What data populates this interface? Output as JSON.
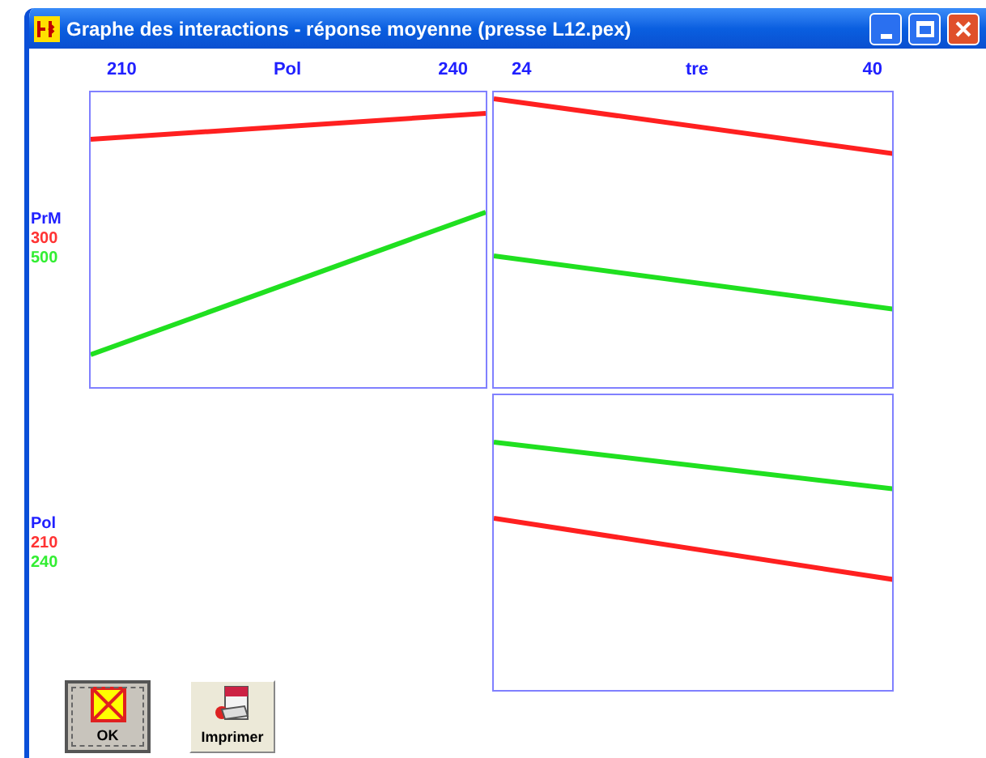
{
  "window": {
    "title": "Graphe des interactions - réponse moyenne (presse L12.pex)"
  },
  "axis_headers": [
    {
      "min": "210",
      "name": "Pol",
      "max": "240"
    },
    {
      "min": "24",
      "name": "tre",
      "max": "40"
    }
  ],
  "legends": [
    {
      "factor": "PrM",
      "levels": [
        {
          "label": "300",
          "color": "#ff3333"
        },
        {
          "label": "500",
          "color": "#33ee33"
        }
      ]
    },
    {
      "factor": "Pol",
      "levels": [
        {
          "label": "210",
          "color": "#ff3333"
        },
        {
          "label": "240",
          "color": "#33ee33"
        }
      ]
    }
  ],
  "rows": [
    {
      "cells": [
        {
          "kind": "plot",
          "lines": [
            {
              "color": "#ff2020"
            },
            {
              "color": "#20e020"
            }
          ]
        },
        {
          "kind": "plot",
          "lines": [
            {
              "color": "#ff2020"
            },
            {
              "color": "#20e020"
            }
          ]
        }
      ]
    },
    {
      "cells": [
        {
          "kind": "empty"
        },
        {
          "kind": "plot",
          "lines": [
            {
              "color": "#20e020"
            },
            {
              "color": "#ff2020"
            }
          ]
        }
      ]
    }
  ],
  "buttons": [
    {
      "label": "OK",
      "selected": true
    },
    {
      "label": "Imprimer",
      "selected": false
    }
  ]
}
